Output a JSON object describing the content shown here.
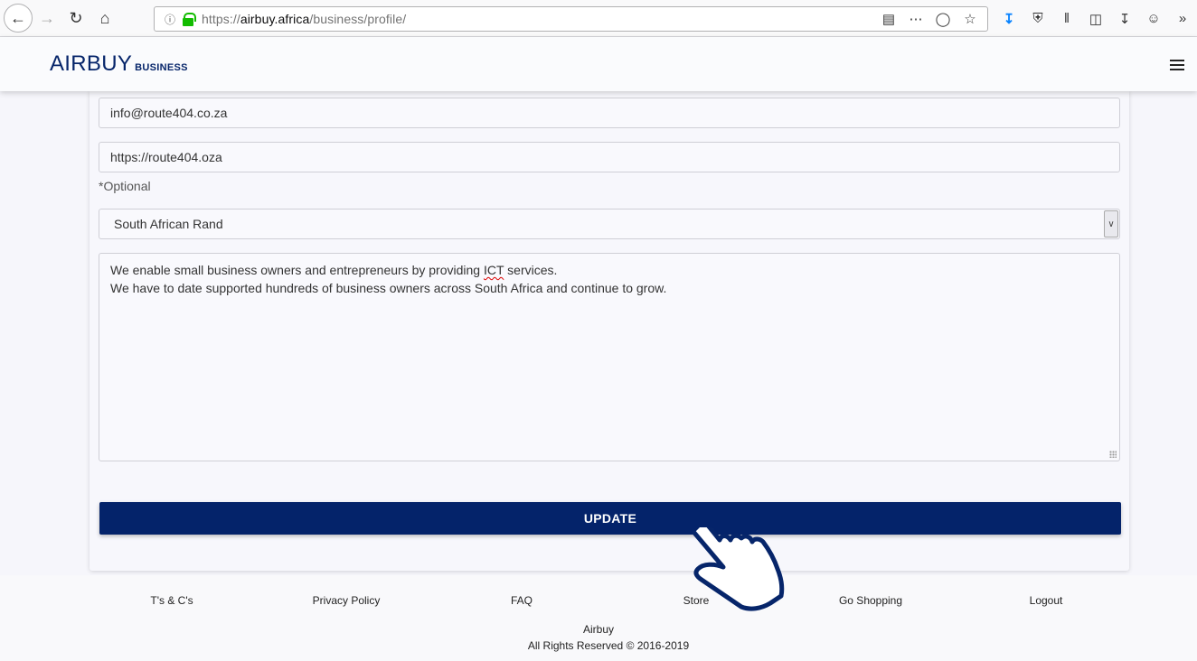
{
  "browser": {
    "url_prefix": "https://",
    "url_host": "airbuy.africa",
    "url_path": "/business/profile/"
  },
  "header": {
    "brand": "AIRBUY",
    "brand_sub": "BUSINESS"
  },
  "form": {
    "email": "info@route404.co.za",
    "website": "https://route404.oza",
    "optional_note": "*Optional",
    "currency": "South African Rand",
    "description_line1_before": "We enable small business owners and entrepreneurs by providing ",
    "description_misspelled": "ICT",
    "description_line1_after": " services.",
    "description_line2": "We have to date supported hundreds of business owners across South Africa and continue to grow.",
    "update_label": "UPDATE"
  },
  "footer": {
    "links": [
      "T's & C's",
      "Privacy Policy",
      "FAQ",
      "Store",
      "Go Shopping",
      "Logout"
    ],
    "company": "Airbuy",
    "rights": "All Rights Reserved © 2016-2019"
  },
  "colors": {
    "brand_navy": "#04236a",
    "secure_green": "#12bc00",
    "download_blue": "#0a84ff"
  }
}
